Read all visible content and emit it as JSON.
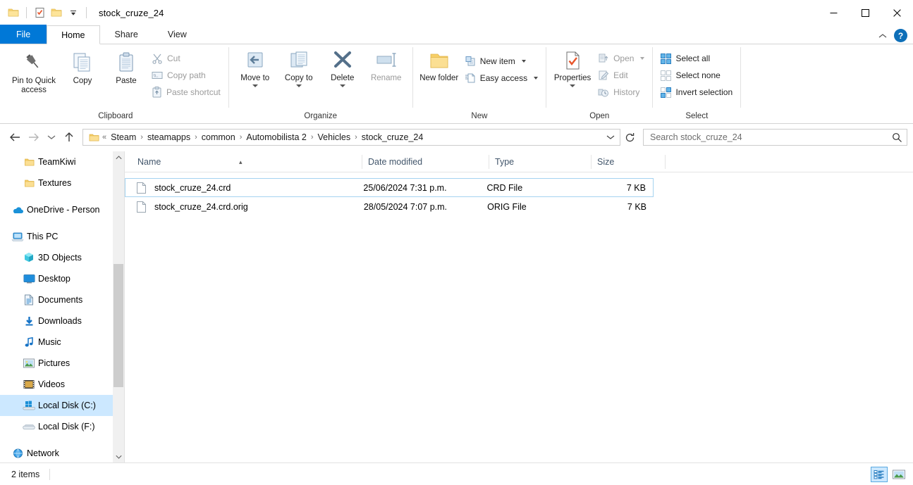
{
  "window": {
    "title": "stock_cruze_24",
    "controls": {
      "minimize": "minimize-icon",
      "maximize": "maximize-icon",
      "close": "close-icon"
    },
    "quick_access": [
      "folder-icon",
      "properties-checklist-icon",
      "new-folder-icon",
      "customize-qat-dropdown"
    ]
  },
  "tabs": [
    {
      "label": "File",
      "id": "file"
    },
    {
      "label": "Home",
      "id": "home"
    },
    {
      "label": "Share",
      "id": "share"
    },
    {
      "label": "View",
      "id": "view"
    }
  ],
  "tab_active": "Home",
  "tabbar_right": {
    "collapse_ribbon": "chevron-up-icon",
    "help": "?"
  },
  "ribbon": {
    "groups": [
      {
        "label": "Clipboard",
        "big": [
          {
            "label": "Pin to Quick access",
            "icon": "pin-icon",
            "enabled": true
          },
          {
            "label": "Copy",
            "icon": "copy-icon",
            "enabled": true
          },
          {
            "label": "Paste",
            "icon": "paste-icon",
            "enabled": true
          }
        ],
        "small": [
          {
            "label": "Cut",
            "icon": "scissors-icon",
            "enabled": false
          },
          {
            "label": "Copy path",
            "icon": "copy-path-icon",
            "enabled": false
          },
          {
            "label": "Paste shortcut",
            "icon": "paste-shortcut-icon",
            "enabled": false
          }
        ]
      },
      {
        "label": "Organize",
        "big": [
          {
            "label": "Move to",
            "icon": "move-to-icon",
            "enabled": true,
            "dropdown": true
          },
          {
            "label": "Copy to",
            "icon": "copy-to-icon",
            "enabled": true,
            "dropdown": true
          },
          {
            "label": "Delete",
            "icon": "delete-x-icon",
            "enabled": true,
            "dropdown": true
          },
          {
            "label": "Rename",
            "icon": "rename-icon",
            "enabled": false
          }
        ],
        "small": []
      },
      {
        "label": "New",
        "big": [
          {
            "label": "New folder",
            "icon": "new-folder-icon",
            "enabled": true
          }
        ],
        "small": [
          {
            "label": "New item",
            "icon": "new-item-icon",
            "enabled": true,
            "dropdown": true
          },
          {
            "label": "Easy access",
            "icon": "easy-access-icon",
            "enabled": true,
            "dropdown": true
          }
        ]
      },
      {
        "label": "Open",
        "big": [
          {
            "label": "Properties",
            "icon": "properties-icon",
            "enabled": true,
            "dropdown": true
          }
        ],
        "small": [
          {
            "label": "Open",
            "icon": "open-icon",
            "enabled": false,
            "dropdown": true
          },
          {
            "label": "Edit",
            "icon": "edit-icon",
            "enabled": false
          },
          {
            "label": "History",
            "icon": "history-icon",
            "enabled": false
          }
        ]
      },
      {
        "label": "Select",
        "big": [],
        "small": [
          {
            "label": "Select all",
            "icon": "select-all-icon",
            "enabled": true
          },
          {
            "label": "Select none",
            "icon": "select-none-icon",
            "enabled": true
          },
          {
            "label": "Invert selection",
            "icon": "invert-selection-icon",
            "enabled": true
          }
        ]
      }
    ]
  },
  "address": {
    "back": "back-arrow-icon",
    "forward": "forward-arrow-icon",
    "recent": "recent-locations-icon",
    "up": "up-arrow-icon",
    "overflow": "«",
    "breadcrumbs": [
      "Steam",
      "steamapps",
      "common",
      "Automobilista 2",
      "Vehicles",
      "stock_cruze_24"
    ],
    "dropdown": "chevron-down-icon",
    "refresh": "refresh-icon"
  },
  "search": {
    "placeholder": "Search stock_cruze_24",
    "value": "",
    "icon": "search-icon"
  },
  "nav_pane": {
    "items": [
      {
        "label": "TeamKiwi",
        "icon": "folder-icon",
        "level": 2,
        "selected": false
      },
      {
        "label": "Textures",
        "icon": "folder-icon",
        "level": 2,
        "selected": false
      },
      {
        "label": "OneDrive - Person",
        "icon": "onedrive-cloud-icon",
        "level": 1,
        "selected": false
      },
      {
        "label": "This PC",
        "icon": "this-pc-icon",
        "level": 1,
        "selected": false
      },
      {
        "label": "3D Objects",
        "icon": "3d-objects-icon",
        "level": 2,
        "selected": false
      },
      {
        "label": "Desktop",
        "icon": "desktop-icon",
        "level": 2,
        "selected": false
      },
      {
        "label": "Documents",
        "icon": "documents-icon",
        "level": 2,
        "selected": false
      },
      {
        "label": "Downloads",
        "icon": "downloads-icon",
        "level": 2,
        "selected": false
      },
      {
        "label": "Music",
        "icon": "music-icon",
        "level": 2,
        "selected": false
      },
      {
        "label": "Pictures",
        "icon": "pictures-icon",
        "level": 2,
        "selected": false
      },
      {
        "label": "Videos",
        "icon": "videos-icon",
        "level": 2,
        "selected": false
      },
      {
        "label": "Local Disk (C:)",
        "icon": "windows-disk-icon",
        "level": 2,
        "selected": true
      },
      {
        "label": "Local Disk (F:)",
        "icon": "disk-icon",
        "level": 2,
        "selected": false
      },
      {
        "label": "Network",
        "icon": "network-icon",
        "level": 1,
        "selected": false
      }
    ]
  },
  "file_list": {
    "columns": [
      {
        "label": "Name",
        "sorted": "asc"
      },
      {
        "label": "Date modified",
        "sorted": ""
      },
      {
        "label": "Type",
        "sorted": ""
      },
      {
        "label": "Size",
        "sorted": ""
      }
    ],
    "rows": [
      {
        "name": "stock_cruze_24.crd",
        "date_modified": "25/06/2024 7:31 p.m.",
        "type": "CRD File",
        "size": "7 KB",
        "icon": "file-icon",
        "selected": true
      },
      {
        "name": "stock_cruze_24.crd.orig",
        "date_modified": "28/05/2024 7:07 p.m.",
        "type": "ORIG File",
        "size": "7 KB",
        "icon": "file-icon",
        "selected": false
      }
    ]
  },
  "status": {
    "item_count": "2 items",
    "view_details": "details-view-icon",
    "view_large_icons": "large-icons-view-icon"
  },
  "colors": {
    "accent": "#0078d7",
    "selection": "#cce8ff",
    "selection_border": "#a5d3f0",
    "header_text": "#42566b",
    "folder_yellow": "#fcd672"
  }
}
